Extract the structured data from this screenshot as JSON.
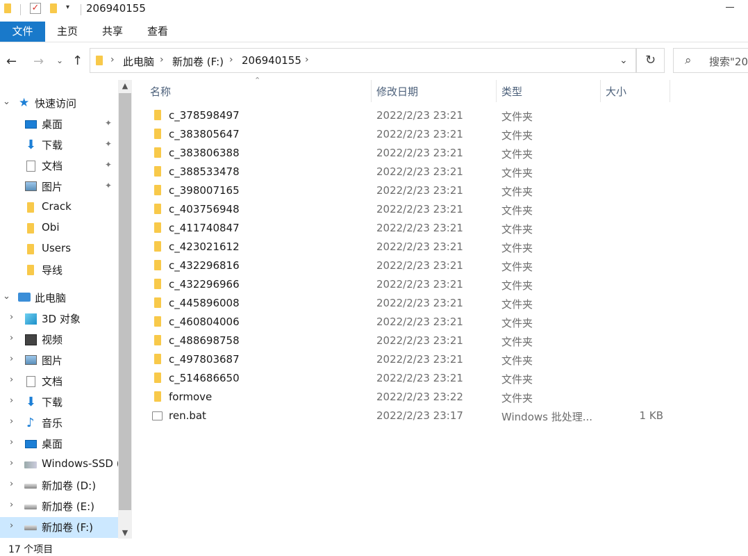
{
  "window": {
    "title": "206940155"
  },
  "ribbon": {
    "tabs": [
      "文件",
      "主页",
      "共享",
      "查看"
    ]
  },
  "address": {
    "crumbs": [
      "此电脑",
      "新加卷 (F:)",
      "206940155"
    ]
  },
  "search": {
    "placeholder": "搜索\"20"
  },
  "nav_pane": {
    "quick_access_label": "快速访问",
    "quick_access": [
      "桌面",
      "下载",
      "文档",
      "图片",
      "Crack",
      "Obi",
      "Users",
      "导线"
    ],
    "this_pc_label": "此电脑",
    "this_pc": [
      "3D 对象",
      "视频",
      "图片",
      "文档",
      "下载",
      "音乐",
      "桌面",
      "Windows-SSD (",
      "新加卷 (D:)",
      "新加卷 (E:)",
      "新加卷 (F:)"
    ]
  },
  "columns": {
    "name": "名称",
    "date": "修改日期",
    "type": "类型",
    "size": "大小"
  },
  "files": [
    {
      "name": "c_378598497",
      "date": "2022/2/23 23:21",
      "type": "文件夹",
      "size": "",
      "icon": "folder"
    },
    {
      "name": "c_383805647",
      "date": "2022/2/23 23:21",
      "type": "文件夹",
      "size": "",
      "icon": "folder"
    },
    {
      "name": "c_383806388",
      "date": "2022/2/23 23:21",
      "type": "文件夹",
      "size": "",
      "icon": "folder"
    },
    {
      "name": "c_388533478",
      "date": "2022/2/23 23:21",
      "type": "文件夹",
      "size": "",
      "icon": "folder"
    },
    {
      "name": "c_398007165",
      "date": "2022/2/23 23:21",
      "type": "文件夹",
      "size": "",
      "icon": "folder"
    },
    {
      "name": "c_403756948",
      "date": "2022/2/23 23:21",
      "type": "文件夹",
      "size": "",
      "icon": "folder"
    },
    {
      "name": "c_411740847",
      "date": "2022/2/23 23:21",
      "type": "文件夹",
      "size": "",
      "icon": "folder"
    },
    {
      "name": "c_423021612",
      "date": "2022/2/23 23:21",
      "type": "文件夹",
      "size": "",
      "icon": "folder"
    },
    {
      "name": "c_432296816",
      "date": "2022/2/23 23:21",
      "type": "文件夹",
      "size": "",
      "icon": "folder"
    },
    {
      "name": "c_432296966",
      "date": "2022/2/23 23:21",
      "type": "文件夹",
      "size": "",
      "icon": "folder"
    },
    {
      "name": "c_445896008",
      "date": "2022/2/23 23:21",
      "type": "文件夹",
      "size": "",
      "icon": "folder"
    },
    {
      "name": "c_460804006",
      "date": "2022/2/23 23:21",
      "type": "文件夹",
      "size": "",
      "icon": "folder"
    },
    {
      "name": "c_488698758",
      "date": "2022/2/23 23:21",
      "type": "文件夹",
      "size": "",
      "icon": "folder"
    },
    {
      "name": "c_497803687",
      "date": "2022/2/23 23:21",
      "type": "文件夹",
      "size": "",
      "icon": "folder"
    },
    {
      "name": "c_514686650",
      "date": "2022/2/23 23:21",
      "type": "文件夹",
      "size": "",
      "icon": "folder"
    },
    {
      "name": "formove",
      "date": "2022/2/23 23:22",
      "type": "文件夹",
      "size": "",
      "icon": "folder"
    },
    {
      "name": "ren.bat",
      "date": "2022/2/23 23:17",
      "type": "Windows 批处理...",
      "size": "1 KB",
      "icon": "bat"
    }
  ],
  "status": {
    "item_count": "17 个项目"
  },
  "colors": {
    "accent": "#1979ca",
    "selection": "#cce8ff",
    "folder": "#f8c94a",
    "header_text": "#4c607a"
  }
}
